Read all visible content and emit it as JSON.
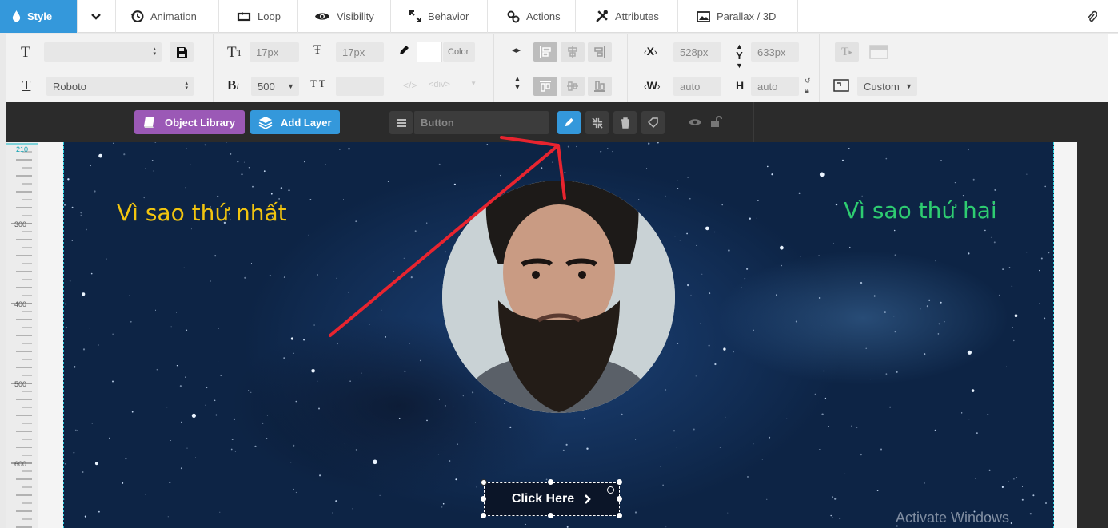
{
  "tabs": [
    {
      "label": "Style",
      "icon": "droplet-icon"
    },
    {
      "label": "Animation",
      "icon": "history-icon"
    },
    {
      "label": "Loop",
      "icon": "loop-icon"
    },
    {
      "label": "Visibility",
      "icon": "eye-icon"
    },
    {
      "label": "Behavior",
      "icon": "expand-icon"
    },
    {
      "label": "Actions",
      "icon": "link-icon"
    },
    {
      "label": "Attributes",
      "icon": "tools-icon"
    },
    {
      "label": "Parallax / 3D",
      "icon": "image-icon"
    }
  ],
  "toolbar": {
    "font_size": "17px",
    "line_height": "17px",
    "color_label": "Color",
    "font_family": "Roboto",
    "font_weight": "500",
    "x_label": "X",
    "x_value": "528px",
    "y_label": "Y",
    "y_value": "633px",
    "w_label": "W",
    "w_value": "auto",
    "h_label": "H",
    "h_value": "auto",
    "tag_placeholder": "<div>",
    "custom_label": "Custom"
  },
  "actionbar": {
    "object_library": "Object Library",
    "add_layer": "Add Layer",
    "layer_name": "Button"
  },
  "ruler": {
    "top_label": "210",
    "marks": [
      "300",
      "400",
      "500",
      "600"
    ]
  },
  "canvas": {
    "text_left": "Vì sao thứ nhất",
    "text_right": "Vì sao thứ hai",
    "button_label": "Click Here",
    "watermark": "Activate Windows",
    "colors": {
      "text_left": "#f1c40f",
      "text_right": "#2ecc71",
      "accent": "#3498db",
      "arrow": "#e8242f"
    }
  }
}
